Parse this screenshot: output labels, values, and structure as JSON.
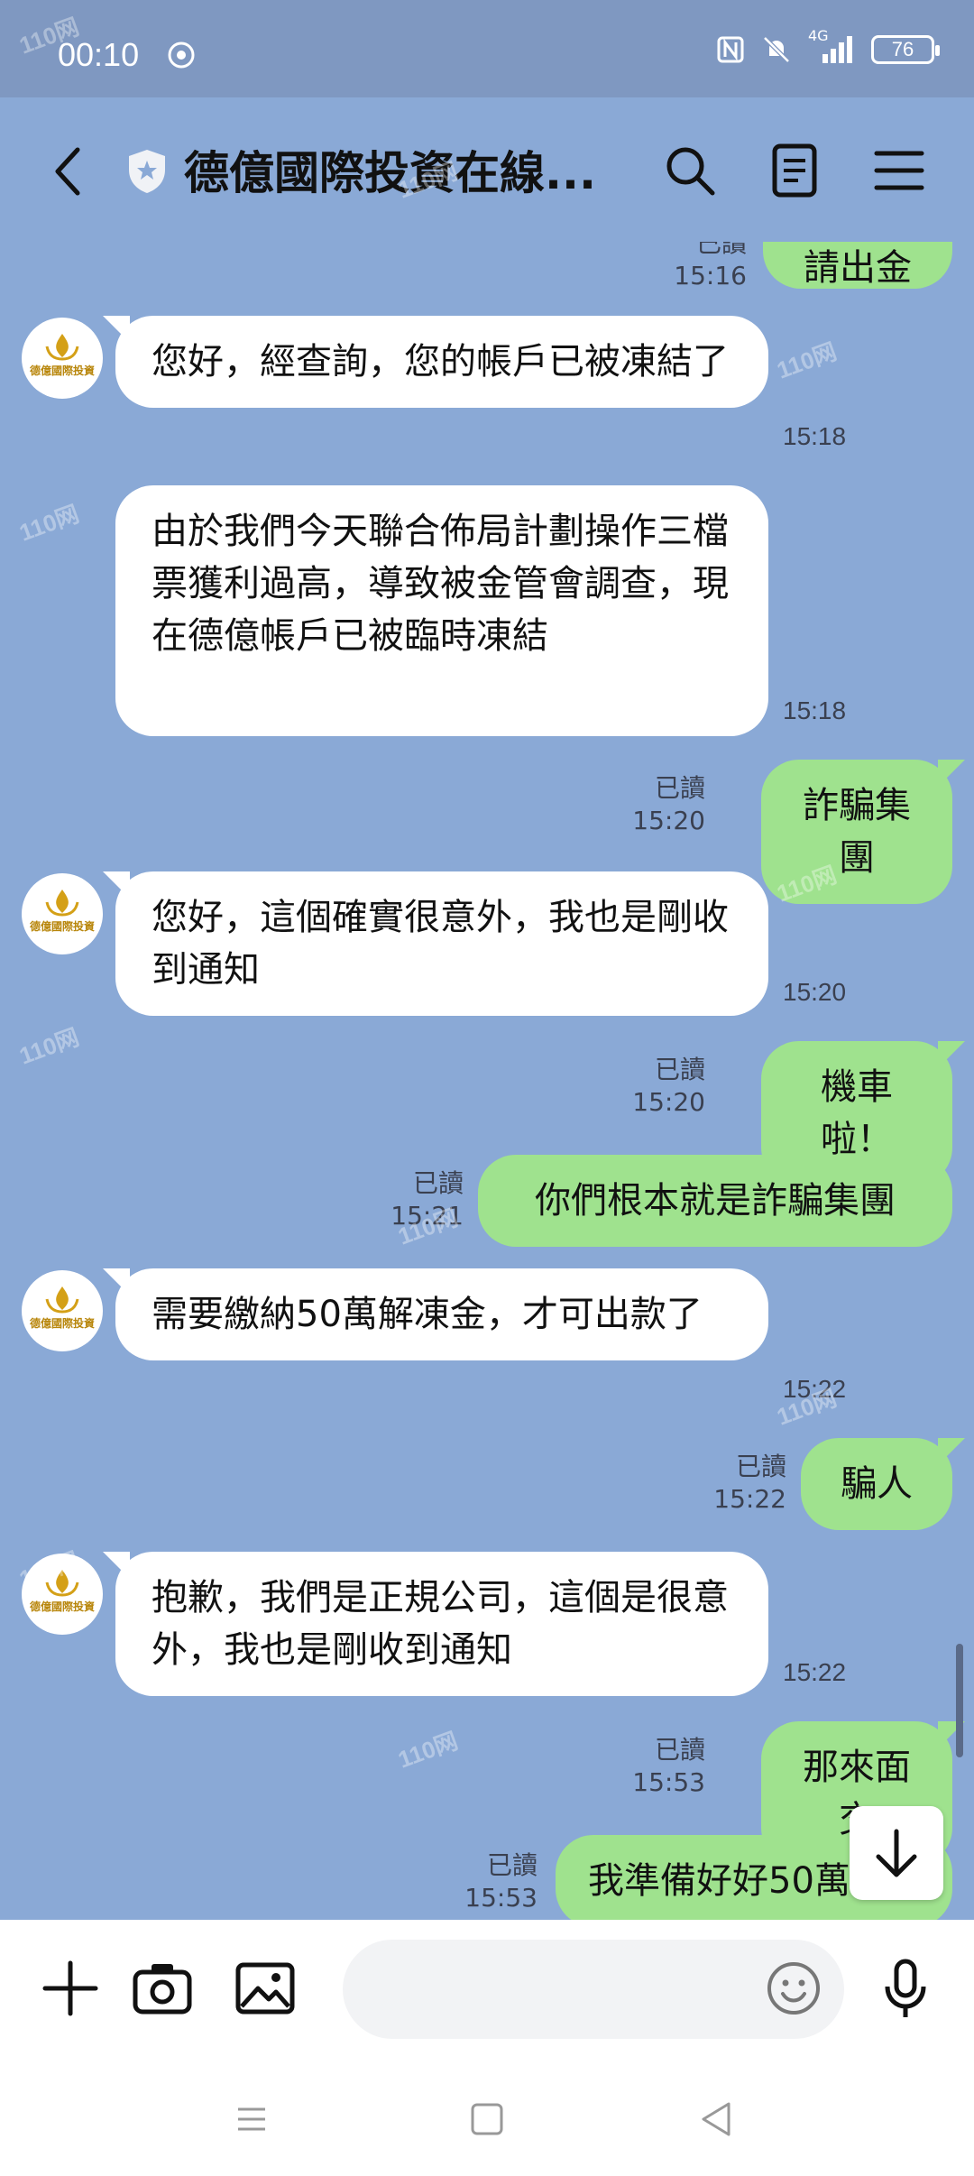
{
  "status_bar": {
    "time": "00:10",
    "network": "4G",
    "battery": "76"
  },
  "header": {
    "title": "德億國際投資在線..."
  },
  "avatar_label": "德億國際投資",
  "messages": [
    {
      "text": "請出金",
      "meta_time": "15:16",
      "read": "已讀"
    },
    {
      "text": "您好，經查詢，您的帳戶已被凍結了",
      "time": "15:18"
    },
    {
      "text": "由於我們今天聯合佈局計劃操作三檔票獲利過高，導致被金管會調查，現在德億帳戶已被臨時凍結",
      "time": "15:18"
    },
    {
      "text": "詐騙集團",
      "time": "15:20",
      "read": "已讀"
    },
    {
      "text": "您好，這個確實很意外，我也是剛收到通知",
      "time": "15:20"
    },
    {
      "text": "機車啦！",
      "time": "15:20",
      "read": "已讀"
    },
    {
      "text": "你們根本就是詐騙集團",
      "time": "15:21",
      "read": "已讀"
    },
    {
      "text": "需要繳納50萬解凍金，才可出款了",
      "time": "15:22"
    },
    {
      "text": "騙人",
      "time": "15:22",
      "read": "已讀"
    },
    {
      "text": "抱歉，我們是正規公司，這個是很意外，我也是剛收到通知",
      "time": "15:22"
    },
    {
      "text": "那來面交",
      "time": "15:53",
      "read": "已讀"
    },
    {
      "text": "我準備好好50萬",
      "time": "15:53",
      "read": "已讀"
    }
  ],
  "watermark": "110网"
}
